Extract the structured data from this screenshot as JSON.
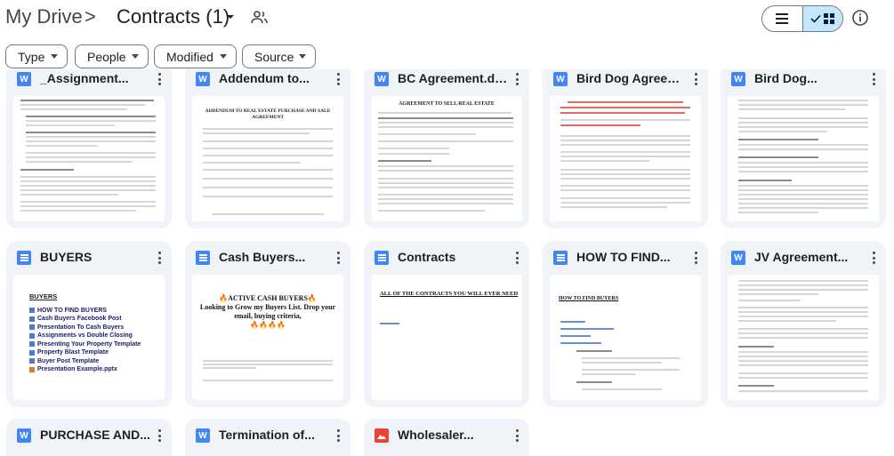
{
  "header": {
    "root": "My Drive",
    "separator": ">",
    "folder": "Contracts (1)",
    "share_icon": "shared-folder-icon",
    "view_list_icon": "list-icon",
    "view_grid_icon": "grid-icon",
    "check_icon": "check-icon",
    "info_icon": "info-icon",
    "selected_view": "grid"
  },
  "filters": [
    {
      "label": "Type"
    },
    {
      "label": "People"
    },
    {
      "label": "Modified"
    },
    {
      "label": "Source"
    }
  ],
  "files": [
    {
      "name": "_Assignment...",
      "type": "word"
    },
    {
      "name": "Addendum to...",
      "type": "word"
    },
    {
      "name": "BC Agreement.docx",
      "type": "word"
    },
    {
      "name": "Bird Dog Agreemen...",
      "type": "word"
    },
    {
      "name": "Bird Dog...",
      "type": "word"
    },
    {
      "name": "BUYERS",
      "type": "doc"
    },
    {
      "name": "Cash Buyers...",
      "type": "doc"
    },
    {
      "name": "Contracts",
      "type": "doc"
    },
    {
      "name": "HOW TO FIND...",
      "type": "doc"
    },
    {
      "name": "JV Agreement...",
      "type": "word"
    },
    {
      "name": "PURCHASE AND...",
      "type": "word"
    },
    {
      "name": "Termination of...",
      "type": "word"
    },
    {
      "name": "Wholesaler...",
      "type": "pdf"
    }
  ],
  "thumbs": {
    "addendum_title": "ADDENDUM TO REAL ESTATE PURCHASE AND SALE AGREEMENT",
    "bc_title": "AGREEMENT TO SELL REAL ESTATE",
    "buyers_heading": "BUYERS",
    "buyers_items": [
      "HOW TO FIND BUYERS",
      "Cash Buyers Facebook Post",
      "Presentation To Cash Buyers",
      "Assignments vs Double Closing",
      "Presenting Your Property Template",
      "Property Blast Template",
      "Buyer Post Template",
      "Presentation Example.pptx"
    ],
    "cash_buyers_title": "🔥ACTIVE CASH BUYERS🔥",
    "cash_buyers_body": "Looking to Grow my Buyers List. Drop your email, buying criteria,",
    "cash_buyers_fire": "🔥🔥🔥🔥",
    "contracts_title": "ALL OF THE CONTRACTS YOU WILL EVER NEED",
    "howto_title": "HOW TO FIND BUYERS"
  }
}
